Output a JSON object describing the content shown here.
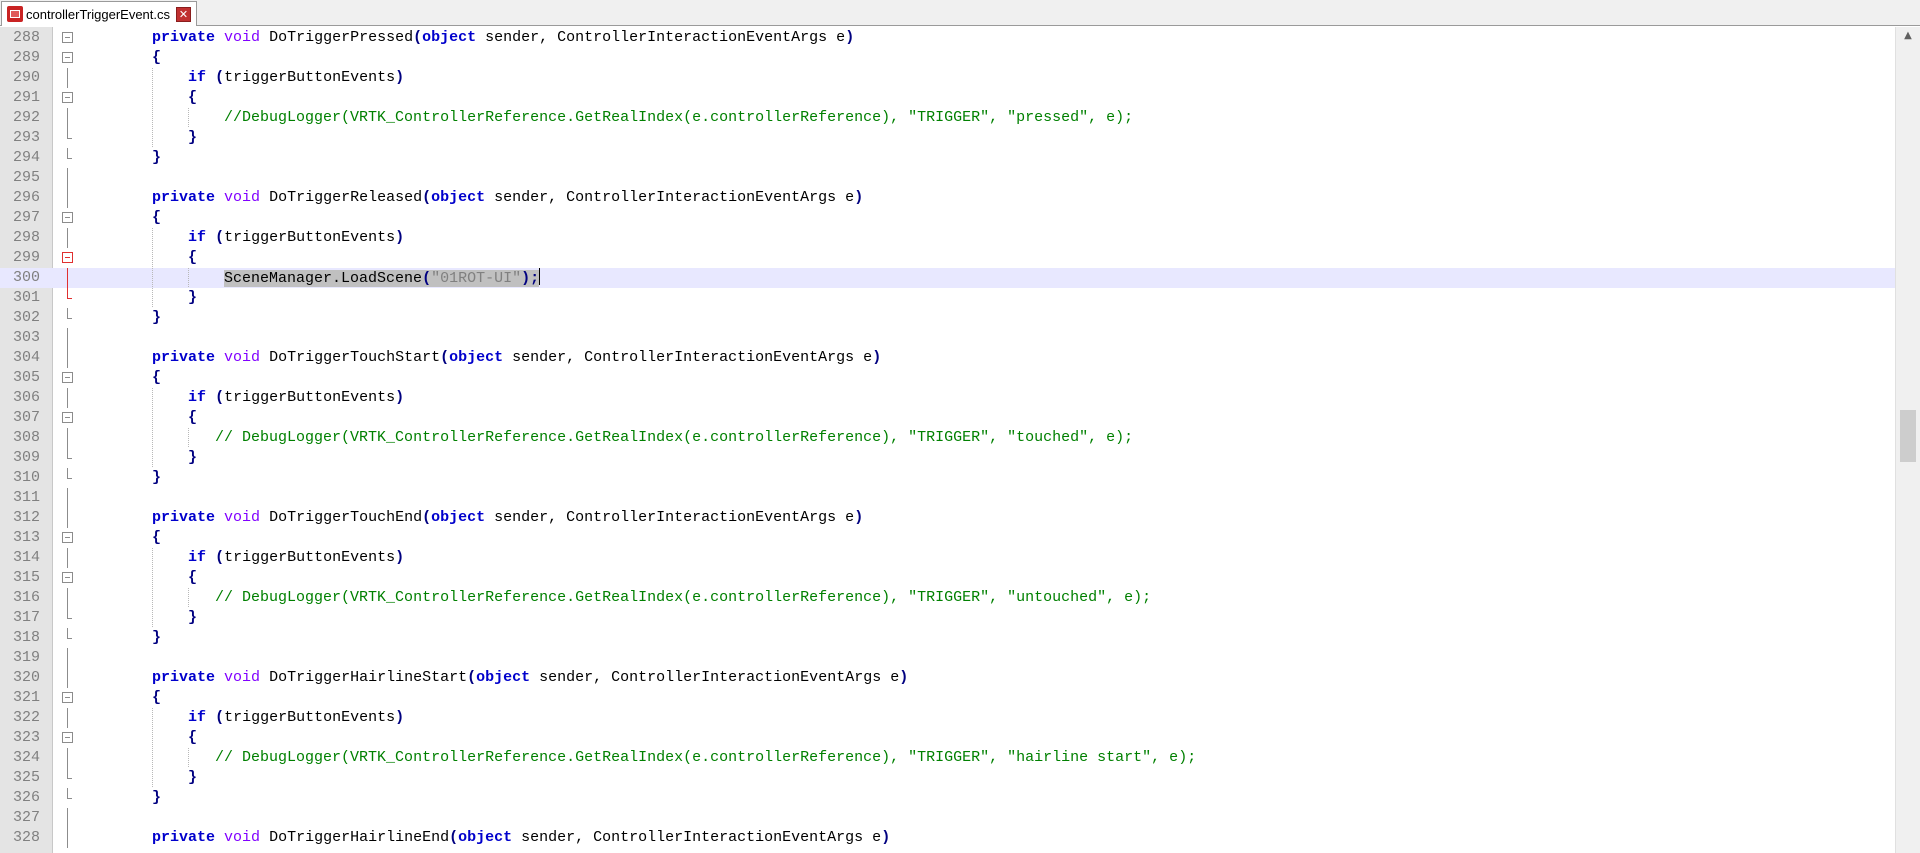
{
  "tabbar": {
    "tabs": [
      {
        "title": "controllerTriggerEvent.cs",
        "icon": "unsaved-file-icon",
        "close_icon": "close-icon",
        "close_glyph": "✕"
      }
    ]
  },
  "editor": {
    "current_line": 300,
    "lines": [
      {
        "n": "288",
        "fold": "box",
        "tokens": [
          {
            "t": "        ",
            "c": "id"
          },
          {
            "t": "private",
            "c": "kw"
          },
          {
            "t": " ",
            "c": "id"
          },
          {
            "t": "void",
            "c": "kw2"
          },
          {
            "t": " DoTriggerPressed",
            "c": "id"
          },
          {
            "t": "(",
            "c": "op"
          },
          {
            "t": "object",
            "c": "kw"
          },
          {
            "t": " sender, ControllerInteractionEventArgs e",
            "c": "id"
          },
          {
            "t": ")",
            "c": "op"
          }
        ]
      },
      {
        "n": "289",
        "fold": "box",
        "tokens": [
          {
            "t": "        ",
            "c": "id"
          },
          {
            "t": "{",
            "c": "op"
          }
        ]
      },
      {
        "n": "290",
        "fold": "line",
        "tokens": [
          {
            "t": "            ",
            "c": "id"
          },
          {
            "t": "if",
            "c": "kw"
          },
          {
            "t": " ",
            "c": "id"
          },
          {
            "t": "(",
            "c": "op"
          },
          {
            "t": "triggerButtonEvents",
            "c": "id"
          },
          {
            "t": ")",
            "c": "op"
          }
        ]
      },
      {
        "n": "291",
        "fold": "box",
        "tokens": [
          {
            "t": "            ",
            "c": "id"
          },
          {
            "t": "{",
            "c": "op"
          }
        ]
      },
      {
        "n": "292",
        "fold": "line",
        "tokens": [
          {
            "t": "                ",
            "c": "id"
          },
          {
            "t": "//DebugLogger(VRTK_ControllerReference.GetRealIndex(e.controllerReference), \"TRIGGER\", \"pressed\", e);",
            "c": "cm"
          }
        ]
      },
      {
        "n": "293",
        "fold": "end",
        "tokens": [
          {
            "t": "            ",
            "c": "id"
          },
          {
            "t": "}",
            "c": "op"
          }
        ]
      },
      {
        "n": "294",
        "fold": "end",
        "tokens": [
          {
            "t": "        ",
            "c": "id"
          },
          {
            "t": "}",
            "c": "op"
          }
        ]
      },
      {
        "n": "295",
        "fold": "line",
        "tokens": []
      },
      {
        "n": "296",
        "fold": "line",
        "tokens": [
          {
            "t": "        ",
            "c": "id"
          },
          {
            "t": "private",
            "c": "kw"
          },
          {
            "t": " ",
            "c": "id"
          },
          {
            "t": "void",
            "c": "kw2"
          },
          {
            "t": " DoTriggerReleased",
            "c": "id"
          },
          {
            "t": "(",
            "c": "op"
          },
          {
            "t": "object",
            "c": "kw"
          },
          {
            "t": " sender, ControllerInteractionEventArgs e",
            "c": "id"
          },
          {
            "t": ")",
            "c": "op"
          }
        ]
      },
      {
        "n": "297",
        "fold": "box",
        "tokens": [
          {
            "t": "        ",
            "c": "id"
          },
          {
            "t": "{",
            "c": "op"
          }
        ]
      },
      {
        "n": "298",
        "fold": "line",
        "tokens": [
          {
            "t": "            ",
            "c": "id"
          },
          {
            "t": "if",
            "c": "kw"
          },
          {
            "t": " ",
            "c": "id"
          },
          {
            "t": "(",
            "c": "op"
          },
          {
            "t": "triggerButtonEvents",
            "c": "id"
          },
          {
            "t": ")",
            "c": "op"
          }
        ]
      },
      {
        "n": "299",
        "fold": "box-red",
        "tokens": [
          {
            "t": "            ",
            "c": "id"
          },
          {
            "t": "{",
            "c": "op"
          }
        ]
      },
      {
        "n": "300",
        "fold": "line-red",
        "tokens": [
          {
            "t": "                ",
            "c": "id"
          },
          {
            "t": "SceneManager.LoadScene",
            "c": "id sel"
          },
          {
            "t": "(",
            "c": "op sel"
          },
          {
            "t": "\"01ROT-UI\"",
            "c": "st sel"
          },
          {
            "t": ");",
            "c": "op sel"
          },
          {
            "t": "",
            "c": "caret"
          }
        ]
      },
      {
        "n": "301",
        "fold": "end-red",
        "tokens": [
          {
            "t": "            ",
            "c": "id"
          },
          {
            "t": "}",
            "c": "op"
          }
        ]
      },
      {
        "n": "302",
        "fold": "end",
        "tokens": [
          {
            "t": "        ",
            "c": "id"
          },
          {
            "t": "}",
            "c": "op"
          }
        ]
      },
      {
        "n": "303",
        "fold": "line",
        "tokens": []
      },
      {
        "n": "304",
        "fold": "line",
        "tokens": [
          {
            "t": "        ",
            "c": "id"
          },
          {
            "t": "private",
            "c": "kw"
          },
          {
            "t": " ",
            "c": "id"
          },
          {
            "t": "void",
            "c": "kw2"
          },
          {
            "t": " DoTriggerTouchStart",
            "c": "id"
          },
          {
            "t": "(",
            "c": "op"
          },
          {
            "t": "object",
            "c": "kw"
          },
          {
            "t": " sender, ControllerInteractionEventArgs e",
            "c": "id"
          },
          {
            "t": ")",
            "c": "op"
          }
        ]
      },
      {
        "n": "305",
        "fold": "box",
        "tokens": [
          {
            "t": "        ",
            "c": "id"
          },
          {
            "t": "{",
            "c": "op"
          }
        ]
      },
      {
        "n": "306",
        "fold": "line",
        "tokens": [
          {
            "t": "            ",
            "c": "id"
          },
          {
            "t": "if",
            "c": "kw"
          },
          {
            "t": " ",
            "c": "id"
          },
          {
            "t": "(",
            "c": "op"
          },
          {
            "t": "triggerButtonEvents",
            "c": "id"
          },
          {
            "t": ")",
            "c": "op"
          }
        ]
      },
      {
        "n": "307",
        "fold": "box",
        "tokens": [
          {
            "t": "            ",
            "c": "id"
          },
          {
            "t": "{",
            "c": "op"
          }
        ]
      },
      {
        "n": "308",
        "fold": "line",
        "tokens": [
          {
            "t": "               ",
            "c": "id"
          },
          {
            "t": "// DebugLogger(VRTK_ControllerReference.GetRealIndex(e.controllerReference), \"TRIGGER\", \"touched\", e);",
            "c": "cm"
          }
        ]
      },
      {
        "n": "309",
        "fold": "end",
        "tokens": [
          {
            "t": "            ",
            "c": "id"
          },
          {
            "t": "}",
            "c": "op"
          }
        ]
      },
      {
        "n": "310",
        "fold": "end",
        "tokens": [
          {
            "t": "        ",
            "c": "id"
          },
          {
            "t": "}",
            "c": "op"
          }
        ]
      },
      {
        "n": "311",
        "fold": "line",
        "tokens": []
      },
      {
        "n": "312",
        "fold": "line",
        "tokens": [
          {
            "t": "        ",
            "c": "id"
          },
          {
            "t": "private",
            "c": "kw"
          },
          {
            "t": " ",
            "c": "id"
          },
          {
            "t": "void",
            "c": "kw2"
          },
          {
            "t": " DoTriggerTouchEnd",
            "c": "id"
          },
          {
            "t": "(",
            "c": "op"
          },
          {
            "t": "object",
            "c": "kw"
          },
          {
            "t": " sender, ControllerInteractionEventArgs e",
            "c": "id"
          },
          {
            "t": ")",
            "c": "op"
          }
        ]
      },
      {
        "n": "313",
        "fold": "box",
        "tokens": [
          {
            "t": "        ",
            "c": "id"
          },
          {
            "t": "{",
            "c": "op"
          }
        ]
      },
      {
        "n": "314",
        "fold": "line",
        "tokens": [
          {
            "t": "            ",
            "c": "id"
          },
          {
            "t": "if",
            "c": "kw"
          },
          {
            "t": " ",
            "c": "id"
          },
          {
            "t": "(",
            "c": "op"
          },
          {
            "t": "triggerButtonEvents",
            "c": "id"
          },
          {
            "t": ")",
            "c": "op"
          }
        ]
      },
      {
        "n": "315",
        "fold": "box",
        "tokens": [
          {
            "t": "            ",
            "c": "id"
          },
          {
            "t": "{",
            "c": "op"
          }
        ]
      },
      {
        "n": "316",
        "fold": "line",
        "tokens": [
          {
            "t": "               ",
            "c": "id"
          },
          {
            "t": "// DebugLogger(VRTK_ControllerReference.GetRealIndex(e.controllerReference), \"TRIGGER\", \"untouched\", e);",
            "c": "cm"
          }
        ]
      },
      {
        "n": "317",
        "fold": "end",
        "tokens": [
          {
            "t": "            ",
            "c": "id"
          },
          {
            "t": "}",
            "c": "op"
          }
        ]
      },
      {
        "n": "318",
        "fold": "end",
        "tokens": [
          {
            "t": "        ",
            "c": "id"
          },
          {
            "t": "}",
            "c": "op"
          }
        ]
      },
      {
        "n": "319",
        "fold": "line",
        "tokens": []
      },
      {
        "n": "320",
        "fold": "line",
        "tokens": [
          {
            "t": "        ",
            "c": "id"
          },
          {
            "t": "private",
            "c": "kw"
          },
          {
            "t": " ",
            "c": "id"
          },
          {
            "t": "void",
            "c": "kw2"
          },
          {
            "t": " DoTriggerHairlineStart",
            "c": "id"
          },
          {
            "t": "(",
            "c": "op"
          },
          {
            "t": "object",
            "c": "kw"
          },
          {
            "t": " sender, ControllerInteractionEventArgs e",
            "c": "id"
          },
          {
            "t": ")",
            "c": "op"
          }
        ]
      },
      {
        "n": "321",
        "fold": "box",
        "tokens": [
          {
            "t": "        ",
            "c": "id"
          },
          {
            "t": "{",
            "c": "op"
          }
        ]
      },
      {
        "n": "322",
        "fold": "line",
        "tokens": [
          {
            "t": "            ",
            "c": "id"
          },
          {
            "t": "if",
            "c": "kw"
          },
          {
            "t": " ",
            "c": "id"
          },
          {
            "t": "(",
            "c": "op"
          },
          {
            "t": "triggerButtonEvents",
            "c": "id"
          },
          {
            "t": ")",
            "c": "op"
          }
        ]
      },
      {
        "n": "323",
        "fold": "box",
        "tokens": [
          {
            "t": "            ",
            "c": "id"
          },
          {
            "t": "{",
            "c": "op"
          }
        ]
      },
      {
        "n": "324",
        "fold": "line",
        "tokens": [
          {
            "t": "               ",
            "c": "id"
          },
          {
            "t": "// DebugLogger(VRTK_ControllerReference.GetRealIndex(e.controllerReference), \"TRIGGER\", \"hairline start\", e);",
            "c": "cm"
          }
        ]
      },
      {
        "n": "325",
        "fold": "end",
        "tokens": [
          {
            "t": "            ",
            "c": "id"
          },
          {
            "t": "}",
            "c": "op"
          }
        ]
      },
      {
        "n": "326",
        "fold": "end",
        "tokens": [
          {
            "t": "        ",
            "c": "id"
          },
          {
            "t": "}",
            "c": "op"
          }
        ]
      },
      {
        "n": "327",
        "fold": "line",
        "tokens": []
      },
      {
        "n": "328",
        "fold": "line",
        "tokens": [
          {
            "t": "        ",
            "c": "id"
          },
          {
            "t": "private",
            "c": "kw"
          },
          {
            "t": " ",
            "c": "id"
          },
          {
            "t": "void",
            "c": "kw2"
          },
          {
            "t": " DoTriggerHairlineEnd",
            "c": "id"
          },
          {
            "t": "(",
            "c": "op"
          },
          {
            "t": "object",
            "c": "kw"
          },
          {
            "t": " sender, ControllerInteractionEventArgs e",
            "c": "id"
          },
          {
            "t": ")",
            "c": "op"
          }
        ]
      }
    ]
  },
  "scrollbar": {
    "up_arrow_icon": "scroll-up-arrow-icon",
    "up_glyph": "▲",
    "thumb_position_fraction": 0.46
  },
  "colors": {
    "keyword": "#0000cc",
    "type_keyword": "#8000ff",
    "comment": "#008000",
    "string": "#808080",
    "current_line": "#e8e8ff",
    "selection": "#c0c0c0"
  }
}
